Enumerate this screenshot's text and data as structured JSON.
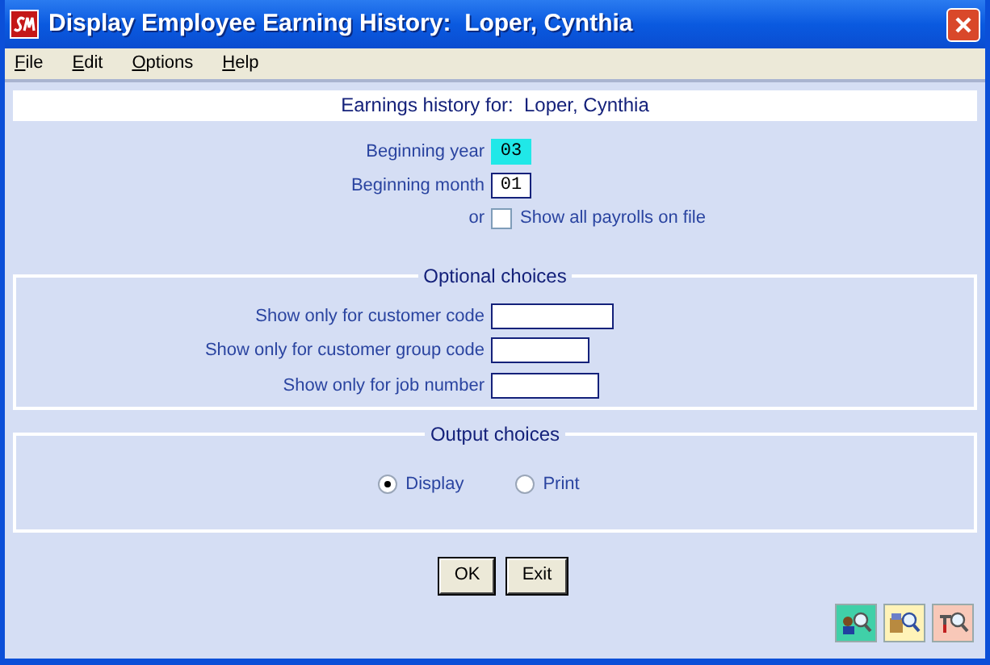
{
  "window": {
    "title": "Display Employee Earning History:  Loper, Cynthia"
  },
  "menu": [
    "File",
    "Edit",
    "Options",
    "Help"
  ],
  "header": "Earnings history for:  Loper, Cynthia",
  "period_fields": [
    {
      "label": "Beginning year",
      "value": "03",
      "focused": true
    },
    {
      "label": "Beginning month",
      "value": "01",
      "focused": false
    }
  ],
  "show_all": {
    "prefix": "or",
    "label": "Show all payrolls on file",
    "checked": false
  },
  "optional_choices": {
    "title": "Optional choices",
    "fields": [
      {
        "label": "Show only for customer code"
      },
      {
        "label": "Show only for customer group code"
      },
      {
        "label": "Show only for job number"
      }
    ]
  },
  "output_choices": {
    "title": "Output choices",
    "options": [
      {
        "label": "Display",
        "selected": true
      },
      {
        "label": "Print",
        "selected": false
      }
    ]
  },
  "buttons": [
    "OK",
    "Exit"
  ]
}
